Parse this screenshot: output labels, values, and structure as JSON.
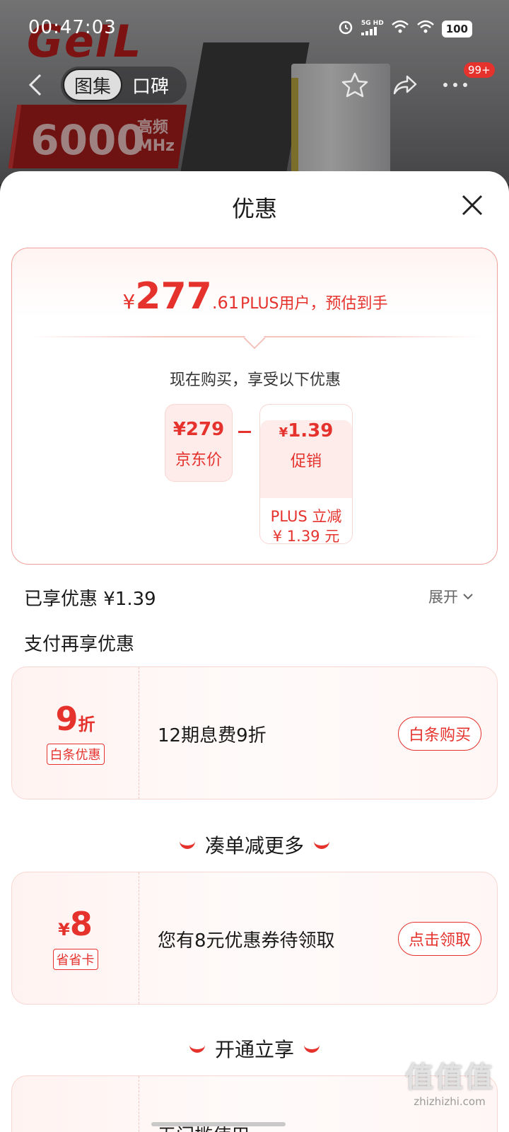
{
  "status_bar": {
    "time": "00:47:03",
    "network": "5G HD",
    "battery": "100"
  },
  "hero": {
    "brand": "GeIL",
    "frequency_value": "6000",
    "frequency_label_top": "高频",
    "frequency_label_bottom": "MHz"
  },
  "nav": {
    "tabs": [
      {
        "label": "图集",
        "active": true
      },
      {
        "label": "口碑",
        "active": false
      }
    ],
    "more_badge": "99+"
  },
  "sheet": {
    "title": "优惠",
    "summary": {
      "currency": "¥",
      "price_int": "277",
      "price_dec": ".61",
      "price_note": "PLUS用户，预估到手",
      "subtitle": "现在购买，享受以下优惠",
      "jd_price_value": "¥279",
      "jd_price_label": "京东价",
      "promo_value_cur": "¥",
      "promo_value": "1.39",
      "promo_label": "促销",
      "promo_detail_line1": "PLUS 立减",
      "promo_detail_line2": "¥ 1.39 元"
    },
    "enjoyed_text": "已享优惠 ¥1.39",
    "expand_label": "展开",
    "pay_section_label": "支付再享优惠",
    "offers": [
      {
        "big_value": "9",
        "big_suffix": "折",
        "tag": "白条优惠",
        "description": "12期息费9折",
        "button": "白条购买"
      },
      {
        "big_prefix": "¥",
        "big_value": "8",
        "tag": "省省卡",
        "description": "您有8元优惠券待领取",
        "button": "点击领取"
      }
    ],
    "combine_section": "凑单减更多",
    "open_section": "开通立享",
    "partial_offer_text": "无门槛使用"
  },
  "watermark": {
    "logo": "值值值",
    "text": "zhizhizhi.com"
  },
  "colors": {
    "accent": "#e5322d",
    "chip_bg": "#fdecea"
  }
}
